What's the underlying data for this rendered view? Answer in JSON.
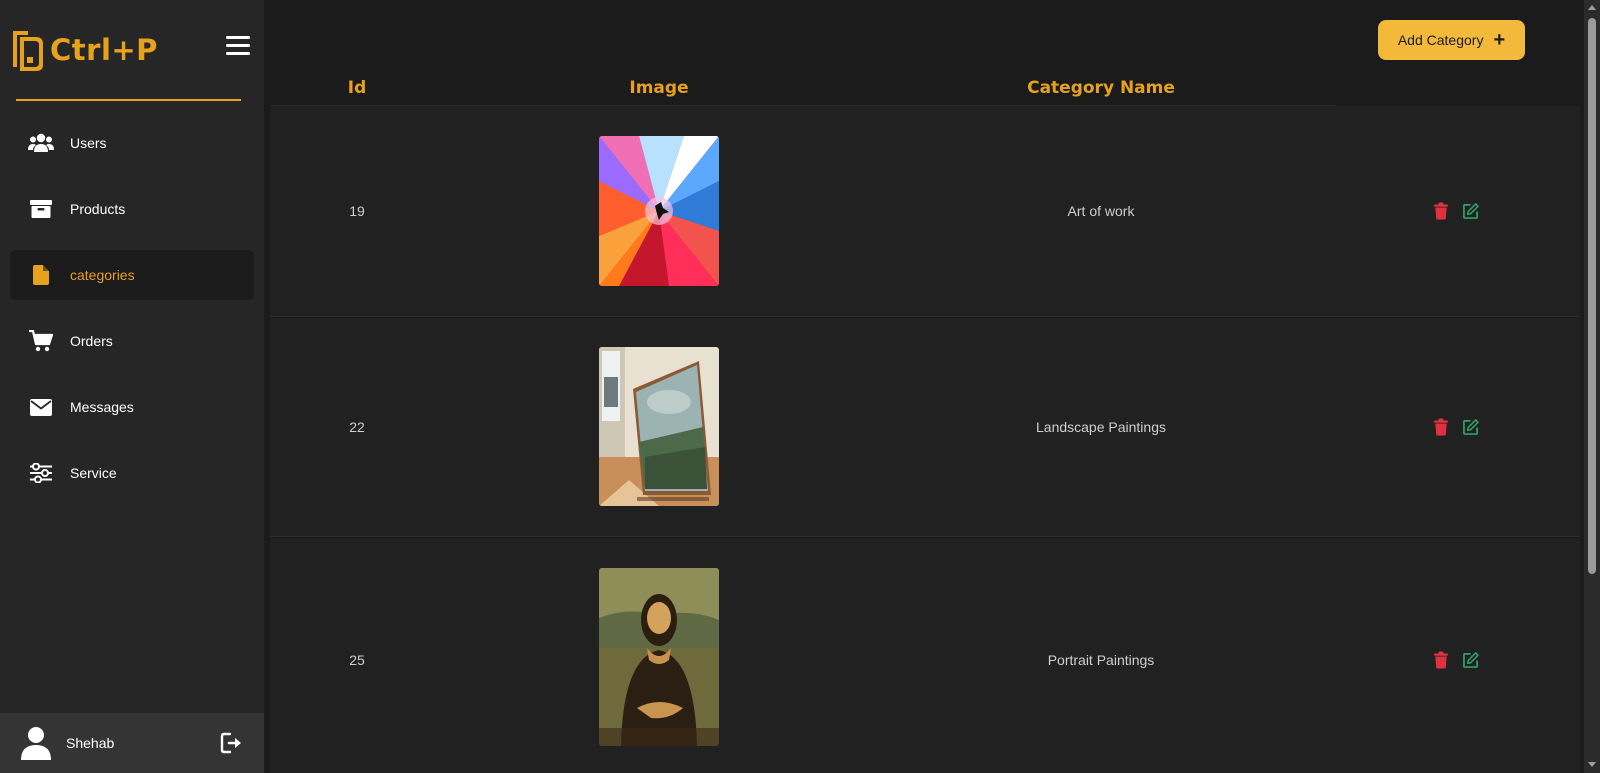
{
  "brand": {
    "name": "Ctrl+P",
    "accent": "#e6a21d"
  },
  "sidebar": {
    "items": [
      {
        "label": "Users",
        "icon": "users-icon"
      },
      {
        "label": "Products",
        "icon": "archive-box-icon"
      },
      {
        "label": "categories",
        "icon": "file-icon",
        "active": true
      },
      {
        "label": "Orders",
        "icon": "cart-icon"
      },
      {
        "label": "Messages",
        "icon": "envelope-icon"
      },
      {
        "label": "Service",
        "icon": "sliders-icon"
      }
    ]
  },
  "user": {
    "name": "Shehab"
  },
  "toolbar": {
    "add_label": "Add Category",
    "add_icon": "plus-icon"
  },
  "table": {
    "headers": [
      "Id",
      "Image",
      "Category Name"
    ],
    "rows": [
      {
        "id": "19",
        "name": "Art of work",
        "image": "abstract-color-explosion-image"
      },
      {
        "id": "22",
        "name": "Landscape Paintings",
        "image": "landscape-painting-by-window-image"
      },
      {
        "id": "25",
        "name": "Portrait Paintings",
        "image": "mona-lisa-portrait-image"
      }
    ]
  },
  "colors": {
    "delete": "#e0313f",
    "edit": "#2fa36b",
    "button": "#f2b93b"
  }
}
